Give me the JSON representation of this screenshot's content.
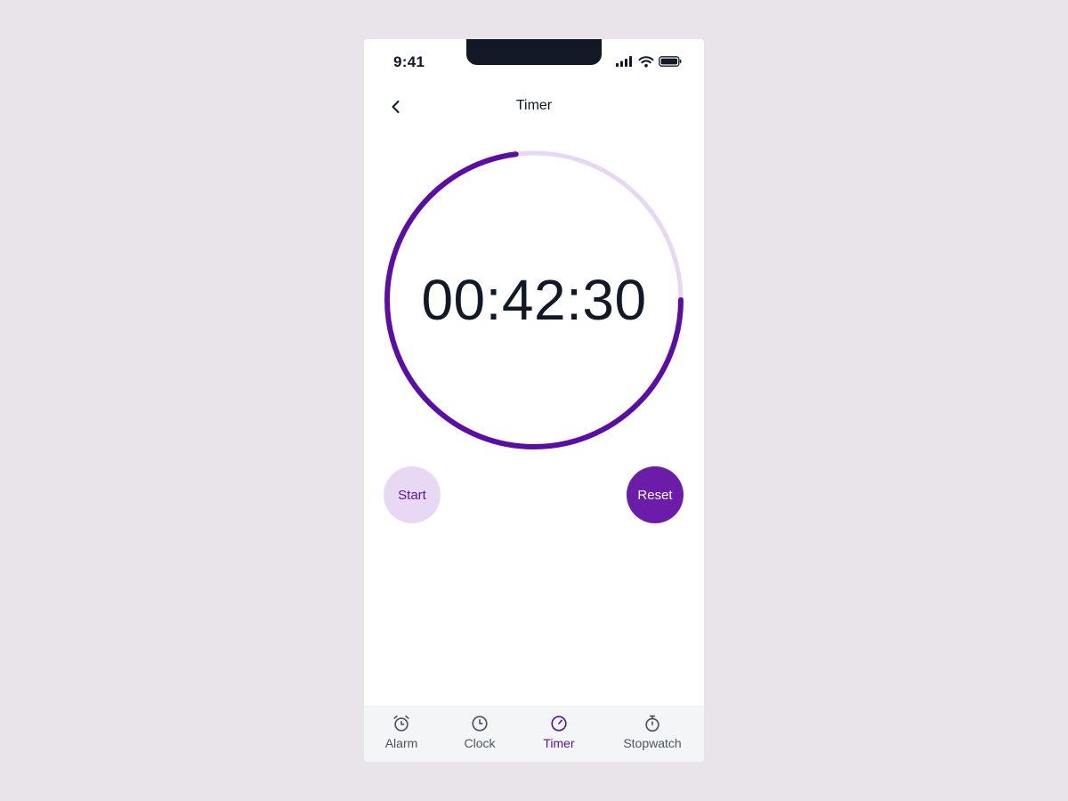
{
  "status_bar": {
    "time": "9:41",
    "icons": [
      "signal-icon",
      "wifi-icon",
      "battery-icon"
    ]
  },
  "header": {
    "title": "Timer",
    "back_icon": "chevron-left-icon"
  },
  "timer": {
    "display": "00:42:30",
    "progress_fraction": 0.73,
    "ring_track_color": "#e7d6f4",
    "ring_progress_color": "#5a0ea3"
  },
  "controls": {
    "start_label": "Start",
    "reset_label": "Reset"
  },
  "tab_bar": {
    "tabs": [
      {
        "label": "Alarm",
        "icon": "alarm-clock-icon",
        "active": false
      },
      {
        "label": "Clock",
        "icon": "clock-icon",
        "active": false
      },
      {
        "label": "Timer",
        "icon": "timer-icon",
        "active": true
      },
      {
        "label": "Stopwatch",
        "icon": "stopwatch-icon",
        "active": false
      }
    ]
  },
  "colors": {
    "background": "#e8e4e9",
    "accent": "#6b1ca8",
    "accent_light": "#e9d8f4",
    "text": "#111827",
    "inactive": "#4b5563"
  }
}
